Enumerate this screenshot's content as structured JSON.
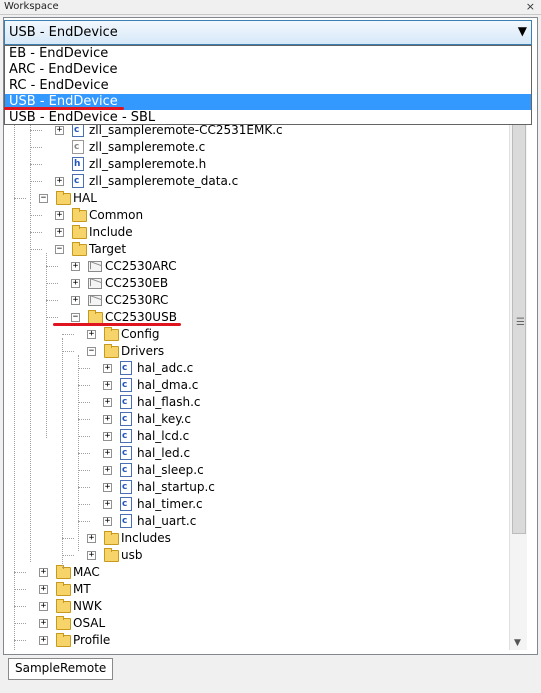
{
  "window": {
    "title": "Workspace",
    "close_glyph": "×"
  },
  "config_select": {
    "value": "USB - EndDevice",
    "arrow": "▼",
    "options": [
      "EB - EndDevice",
      "ARC - EndDevice",
      "RC - EndDevice",
      "USB - EndDevice",
      "USB - EndDevice - SBL"
    ],
    "selected_index": 3
  },
  "tree": {
    "rows": [
      {
        "label": "zll_sampleremote-CC2531EMK.c",
        "kind": "file",
        "depth": 2,
        "toggle": "+"
      },
      {
        "label": "zll_sampleremote.c",
        "kind": "file-excluded",
        "depth": 2,
        "toggle": ""
      },
      {
        "label": "zll_sampleremote.h",
        "kind": "header",
        "depth": 2,
        "toggle": ""
      },
      {
        "label": "zll_sampleremote_data.c",
        "kind": "file",
        "depth": 2,
        "toggle": "+"
      },
      {
        "label": "HAL",
        "kind": "folder",
        "depth": 1,
        "toggle": "−"
      },
      {
        "label": "Common",
        "kind": "folder",
        "depth": 2,
        "toggle": "+"
      },
      {
        "label": "Include",
        "kind": "folder",
        "depth": 2,
        "toggle": "+"
      },
      {
        "label": "Target",
        "kind": "folder",
        "depth": 2,
        "toggle": "−"
      },
      {
        "label": "CC2530ARC",
        "kind": "config",
        "depth": 3,
        "toggle": "+"
      },
      {
        "label": "CC2530EB",
        "kind": "config",
        "depth": 3,
        "toggle": "+"
      },
      {
        "label": "CC2530RC",
        "kind": "config",
        "depth": 3,
        "toggle": "+"
      },
      {
        "label": "CC2530USB",
        "kind": "folder",
        "depth": 3,
        "toggle": "−"
      },
      {
        "label": "Config",
        "kind": "folder",
        "depth": 4,
        "toggle": "+"
      },
      {
        "label": "Drivers",
        "kind": "folder",
        "depth": 4,
        "toggle": "−"
      },
      {
        "label": "hal_adc.c",
        "kind": "file",
        "depth": 5,
        "toggle": "+"
      },
      {
        "label": "hal_dma.c",
        "kind": "file",
        "depth": 5,
        "toggle": "+"
      },
      {
        "label": "hal_flash.c",
        "kind": "file",
        "depth": 5,
        "toggle": "+"
      },
      {
        "label": "hal_key.c",
        "kind": "file",
        "depth": 5,
        "toggle": "+"
      },
      {
        "label": "hal_lcd.c",
        "kind": "file",
        "depth": 5,
        "toggle": "+"
      },
      {
        "label": "hal_led.c",
        "kind": "file",
        "depth": 5,
        "toggle": "+"
      },
      {
        "label": "hal_sleep.c",
        "kind": "file",
        "depth": 5,
        "toggle": "+"
      },
      {
        "label": "hal_startup.c",
        "kind": "file",
        "depth": 5,
        "toggle": "+"
      },
      {
        "label": "hal_timer.c",
        "kind": "file",
        "depth": 5,
        "toggle": "+"
      },
      {
        "label": "hal_uart.c",
        "kind": "file",
        "depth": 5,
        "toggle": "+"
      },
      {
        "label": "Includes",
        "kind": "folder",
        "depth": 4,
        "toggle": "+"
      },
      {
        "label": "usb",
        "kind": "folder",
        "depth": 4,
        "toggle": "+"
      },
      {
        "label": "MAC",
        "kind": "folder",
        "depth": 1,
        "toggle": "+"
      },
      {
        "label": "MT",
        "kind": "folder",
        "depth": 1,
        "toggle": "+"
      },
      {
        "label": "NWK",
        "kind": "folder",
        "depth": 1,
        "toggle": "+"
      },
      {
        "label": "OSAL",
        "kind": "folder",
        "depth": 1,
        "toggle": "+"
      },
      {
        "label": "Profile",
        "kind": "folder",
        "depth": 1,
        "toggle": "+"
      }
    ]
  },
  "scrollbar": {
    "grip": "☰",
    "down_arrow": "▼"
  },
  "tabs": [
    {
      "label": "SampleRemote"
    }
  ],
  "colors": {
    "selection": "#3399ff",
    "annotation": "#e0141e",
    "folder": "#f7d46a"
  }
}
